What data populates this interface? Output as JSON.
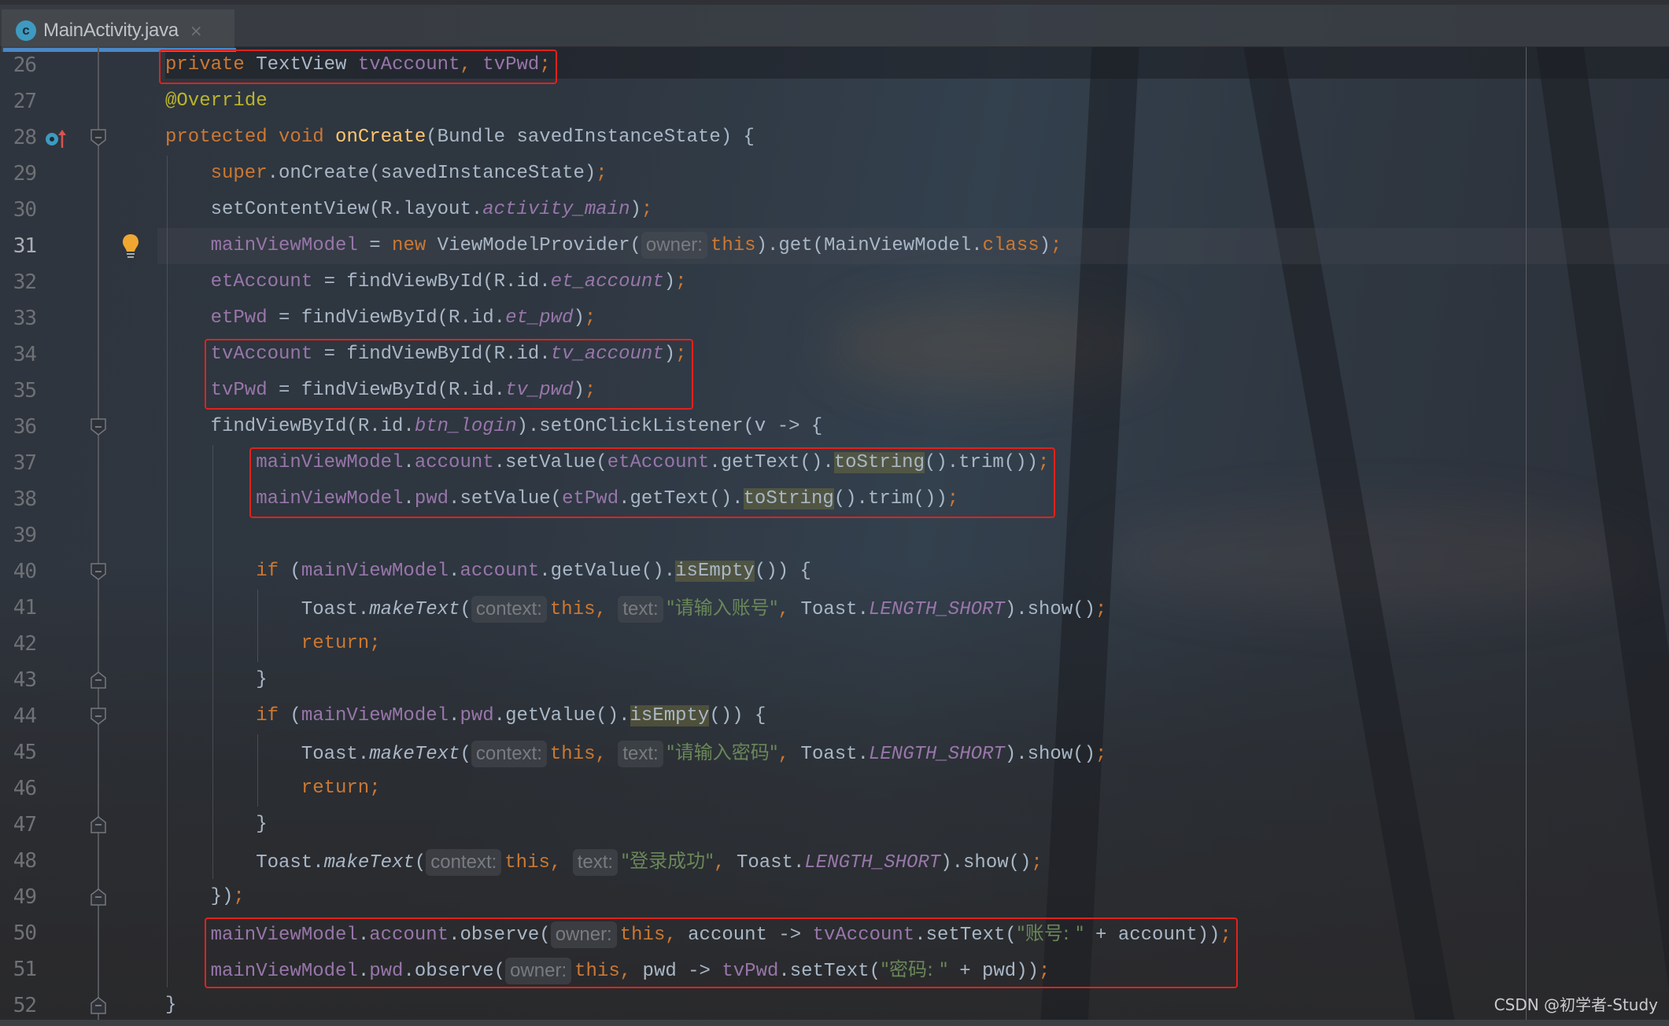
{
  "tab": {
    "icon": "class-icon",
    "icon_letter": "c",
    "filename": "MainActivity.java",
    "close_glyph": "×"
  },
  "editor": {
    "first_line": 26,
    "current_line": 31,
    "lines": [
      {
        "n": 26,
        "indent": 0,
        "tokens": [
          [
            "private",
            "kw"
          ],
          [
            " ",
            "plain"
          ],
          [
            "TextView",
            "type"
          ],
          [
            " ",
            "plain"
          ],
          [
            "tvAccount",
            "field"
          ],
          [
            ",",
            "punct"
          ],
          [
            " ",
            "plain"
          ],
          [
            "tvPwd",
            "field"
          ],
          [
            ";",
            "punct"
          ]
        ]
      },
      {
        "n": 27,
        "indent": 0,
        "tokens": [
          [
            "@Override",
            "ann"
          ]
        ]
      },
      {
        "n": 28,
        "indent": 0,
        "tokens": [
          [
            "protected",
            "kw"
          ],
          [
            " ",
            "plain"
          ],
          [
            "void",
            "kw"
          ],
          [
            " ",
            "plain"
          ],
          [
            "onCreate",
            "fn"
          ],
          [
            "(Bundle savedInstanceState) {",
            "plain"
          ]
        ]
      },
      {
        "n": 29,
        "indent": 1,
        "tokens": [
          [
            "super",
            "kw"
          ],
          [
            ".onCreate(savedInstanceState)",
            "plain"
          ],
          [
            ";",
            "punct"
          ]
        ]
      },
      {
        "n": 30,
        "indent": 1,
        "tokens": [
          [
            "setContentView(R.layout.",
            "plain"
          ],
          [
            "activity_main",
            "static"
          ],
          [
            ")",
            "plain"
          ],
          [
            ";",
            "punct"
          ]
        ]
      },
      {
        "n": 31,
        "indent": 1,
        "tokens": [
          [
            "mainViewModel",
            "field"
          ],
          [
            " = ",
            "plain"
          ],
          [
            "new",
            "kw"
          ],
          [
            " ViewModelProvider(",
            "plain"
          ],
          [
            "owner:",
            "inlay"
          ],
          [
            "this",
            "kw"
          ],
          [
            ").get(MainViewModel.",
            "plain"
          ],
          [
            "class",
            "kw"
          ],
          [
            ")",
            "plain"
          ],
          [
            ";",
            "punct"
          ]
        ]
      },
      {
        "n": 32,
        "indent": 1,
        "tokens": [
          [
            "etAccount",
            "field"
          ],
          [
            " = findViewById(R.id.",
            "plain"
          ],
          [
            "et_account",
            "static"
          ],
          [
            ")",
            "plain"
          ],
          [
            ";",
            "punct"
          ]
        ]
      },
      {
        "n": 33,
        "indent": 1,
        "tokens": [
          [
            "etPwd",
            "field"
          ],
          [
            " = findViewById(R.id.",
            "plain"
          ],
          [
            "et_pwd",
            "static"
          ],
          [
            ")",
            "plain"
          ],
          [
            ";",
            "punct"
          ]
        ]
      },
      {
        "n": 34,
        "indent": 1,
        "tokens": [
          [
            "tvAccount",
            "field"
          ],
          [
            " = findViewById(R.id.",
            "plain"
          ],
          [
            "tv_account",
            "static"
          ],
          [
            ")",
            "plain"
          ],
          [
            ";",
            "punct"
          ]
        ]
      },
      {
        "n": 35,
        "indent": 1,
        "tokens": [
          [
            "tvPwd",
            "field"
          ],
          [
            " = findViewById(R.id.",
            "plain"
          ],
          [
            "tv_pwd",
            "static"
          ],
          [
            ")",
            "plain"
          ],
          [
            ";",
            "punct"
          ]
        ]
      },
      {
        "n": 36,
        "indent": 1,
        "tokens": [
          [
            "findViewById(R.id.",
            "plain"
          ],
          [
            "btn_login",
            "static"
          ],
          [
            ").setOnClickListener(v -> {",
            "plain"
          ]
        ]
      },
      {
        "n": 37,
        "indent": 2,
        "tokens": [
          [
            "mainViewModel",
            "field"
          ],
          [
            ".",
            "plain"
          ],
          [
            "account",
            "field"
          ],
          [
            ".setValue(",
            "plain"
          ],
          [
            "etAccount",
            "field"
          ],
          [
            ".getText().",
            "plain"
          ],
          [
            "toString",
            "hl"
          ],
          [
            "().trim())",
            "plain"
          ],
          [
            ";",
            "punct"
          ]
        ]
      },
      {
        "n": 38,
        "indent": 2,
        "tokens": [
          [
            "mainViewModel",
            "field"
          ],
          [
            ".",
            "plain"
          ],
          [
            "pwd",
            "field"
          ],
          [
            ".setValue(",
            "plain"
          ],
          [
            "etPwd",
            "field"
          ],
          [
            ".getText().",
            "plain"
          ],
          [
            "toString",
            "hl"
          ],
          [
            "().trim())",
            "plain"
          ],
          [
            ";",
            "punct"
          ]
        ]
      },
      {
        "n": 39,
        "indent": 2,
        "tokens": []
      },
      {
        "n": 40,
        "indent": 2,
        "tokens": [
          [
            "if",
            "kw"
          ],
          [
            " (",
            "plain"
          ],
          [
            "mainViewModel",
            "field"
          ],
          [
            ".",
            "plain"
          ],
          [
            "account",
            "field"
          ],
          [
            ".getValue().",
            "plain"
          ],
          [
            "isEmpty",
            "hl"
          ],
          [
            "()) {",
            "plain"
          ]
        ]
      },
      {
        "n": 41,
        "indent": 3,
        "tokens": [
          [
            "Toast.",
            "plain"
          ],
          [
            "makeText",
            "ital"
          ],
          [
            "(",
            "plain"
          ],
          [
            "context:",
            "inlay"
          ],
          [
            "this",
            "kw"
          ],
          [
            ",",
            "punct"
          ],
          [
            " ",
            "plain"
          ],
          [
            "text:",
            "inlay"
          ],
          [
            "\"请输入账号\"",
            "str"
          ],
          [
            ",",
            "punct"
          ],
          [
            " Toast.",
            "plain"
          ],
          [
            "LENGTH_SHORT",
            "static"
          ],
          [
            ").show()",
            "plain"
          ],
          [
            ";",
            "punct"
          ]
        ]
      },
      {
        "n": 42,
        "indent": 3,
        "tokens": [
          [
            "return",
            "kw"
          ],
          [
            ";",
            "punct"
          ]
        ]
      },
      {
        "n": 43,
        "indent": 2,
        "tokens": [
          [
            "}",
            "plain"
          ]
        ]
      },
      {
        "n": 44,
        "indent": 2,
        "tokens": [
          [
            "if",
            "kw"
          ],
          [
            " (",
            "plain"
          ],
          [
            "mainViewModel",
            "field"
          ],
          [
            ".",
            "plain"
          ],
          [
            "pwd",
            "field"
          ],
          [
            ".getValue().",
            "plain"
          ],
          [
            "isEmpty",
            "hl"
          ],
          [
            "()) {",
            "plain"
          ]
        ]
      },
      {
        "n": 45,
        "indent": 3,
        "tokens": [
          [
            "Toast.",
            "plain"
          ],
          [
            "makeText",
            "ital"
          ],
          [
            "(",
            "plain"
          ],
          [
            "context:",
            "inlay"
          ],
          [
            "this",
            "kw"
          ],
          [
            ",",
            "punct"
          ],
          [
            " ",
            "plain"
          ],
          [
            "text:",
            "inlay"
          ],
          [
            "\"请输入密码\"",
            "str"
          ],
          [
            ",",
            "punct"
          ],
          [
            " Toast.",
            "plain"
          ],
          [
            "LENGTH_SHORT",
            "static"
          ],
          [
            ").show()",
            "plain"
          ],
          [
            ";",
            "punct"
          ]
        ]
      },
      {
        "n": 46,
        "indent": 3,
        "tokens": [
          [
            "return",
            "kw"
          ],
          [
            ";",
            "punct"
          ]
        ]
      },
      {
        "n": 47,
        "indent": 2,
        "tokens": [
          [
            "}",
            "plain"
          ]
        ]
      },
      {
        "n": 48,
        "indent": 2,
        "tokens": [
          [
            "Toast.",
            "plain"
          ],
          [
            "makeText",
            "ital"
          ],
          [
            "(",
            "plain"
          ],
          [
            "context:",
            "inlay"
          ],
          [
            "this",
            "kw"
          ],
          [
            ",",
            "punct"
          ],
          [
            " ",
            "plain"
          ],
          [
            "text:",
            "inlay"
          ],
          [
            "\"登录成功\"",
            "str"
          ],
          [
            ",",
            "punct"
          ],
          [
            " Toast.",
            "plain"
          ],
          [
            "LENGTH_SHORT",
            "static"
          ],
          [
            ").show()",
            "plain"
          ],
          [
            ";",
            "punct"
          ]
        ]
      },
      {
        "n": 49,
        "indent": 1,
        "tokens": [
          [
            "})",
            "plain"
          ],
          [
            ";",
            "punct"
          ]
        ]
      },
      {
        "n": 50,
        "indent": 1,
        "tokens": [
          [
            "mainViewModel",
            "field"
          ],
          [
            ".",
            "plain"
          ],
          [
            "account",
            "field"
          ],
          [
            ".observe(",
            "plain"
          ],
          [
            "owner:",
            "inlay"
          ],
          [
            "this",
            "kw"
          ],
          [
            ",",
            "punct"
          ],
          [
            " account -> ",
            "plain"
          ],
          [
            "tvAccount",
            "field"
          ],
          [
            ".setText(",
            "plain"
          ],
          [
            "\"账号: \"",
            "str"
          ],
          [
            " + account))",
            "plain"
          ],
          [
            ";",
            "punct"
          ]
        ]
      },
      {
        "n": 51,
        "indent": 1,
        "tokens": [
          [
            "mainViewModel",
            "field"
          ],
          [
            ".",
            "plain"
          ],
          [
            "pwd",
            "field"
          ],
          [
            ".observe(",
            "plain"
          ],
          [
            "owner:",
            "inlay"
          ],
          [
            "this",
            "kw"
          ],
          [
            ",",
            "punct"
          ],
          [
            " pwd -> ",
            "plain"
          ],
          [
            "tvPwd",
            "field"
          ],
          [
            ".setText(",
            "plain"
          ],
          [
            "\"密码: \"",
            "str"
          ],
          [
            " + pwd))",
            "plain"
          ],
          [
            ";",
            "punct"
          ]
        ]
      },
      {
        "n": 52,
        "indent": 0,
        "tokens": [
          [
            "}",
            "plain"
          ]
        ]
      }
    ],
    "fold_markers": [
      {
        "line": 28,
        "kind": "open"
      },
      {
        "line": 36,
        "kind": "open"
      },
      {
        "line": 40,
        "kind": "open"
      },
      {
        "line": 43,
        "kind": "close"
      },
      {
        "line": 44,
        "kind": "open"
      },
      {
        "line": 47,
        "kind": "close"
      },
      {
        "line": 49,
        "kind": "close"
      },
      {
        "line": 52,
        "kind": "close"
      }
    ],
    "gutter_icons": [
      {
        "line": 28,
        "icon": "overrides-method-icon"
      },
      {
        "line": 31,
        "icon": "lightbulb-icon"
      }
    ],
    "highlight_boxes": [
      {
        "from": 26,
        "to": 26,
        "indent": 0,
        "name": "highlight-field-declaration"
      },
      {
        "from": 34,
        "to": 35,
        "indent": 1,
        "name": "highlight-findviewbyid-textviews"
      },
      {
        "from": 37,
        "to": 38,
        "indent": 2,
        "name": "highlight-setvalue-calls"
      },
      {
        "from": 50,
        "to": 51,
        "indent": 1,
        "name": "highlight-observe-calls"
      }
    ]
  },
  "watermark": "CSDN @初学者-Study",
  "colors": {
    "keyword": "#cc7832",
    "field": "#9876aa",
    "annotation": "#bbb529",
    "method_decl": "#ffc66d",
    "string": "#6a8759",
    "default_text": "#a9b7c6",
    "highlight_box": "#e0221b",
    "tab_underline": "#4a88c7"
  }
}
